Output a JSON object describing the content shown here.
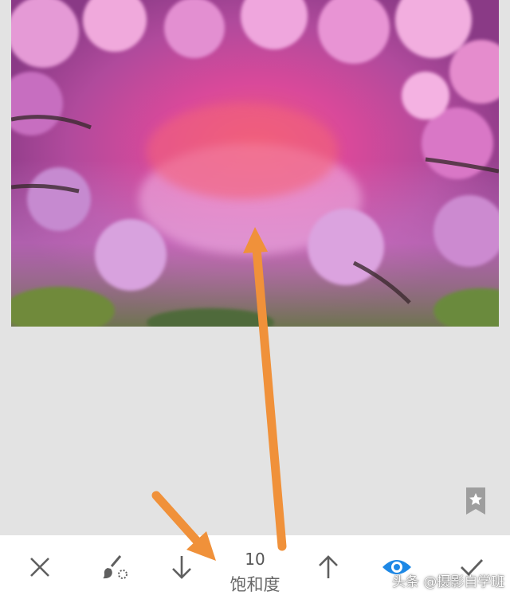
{
  "photo": {
    "subject": "cherry-blossom-tunnel"
  },
  "adjustment": {
    "value": "10",
    "name": "饱和度"
  },
  "toolbar": {
    "cancel_icon": "close-icon",
    "brush_icon": "brush-icon",
    "decrease_icon": "arrow-down-icon",
    "increase_icon": "arrow-up-icon",
    "preview_icon": "eye-icon",
    "apply_icon": "check-icon"
  },
  "watermark": "头条 @摄影自学班",
  "colors": {
    "accent": "#1e88e5",
    "annotation_arrow": "#f0913a",
    "background": "#e3e3e3",
    "toolbar": "#ffffff"
  }
}
